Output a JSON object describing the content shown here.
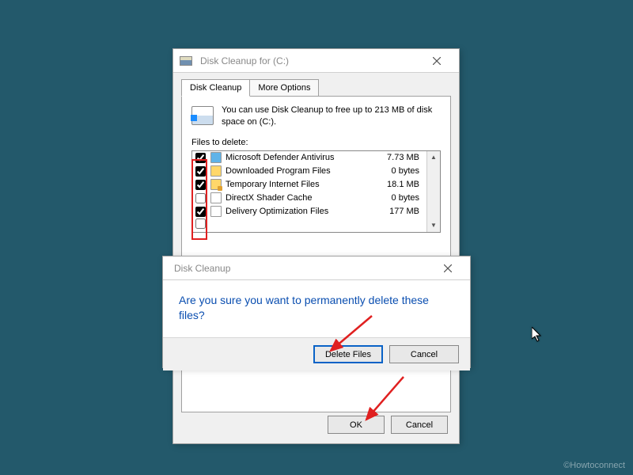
{
  "main": {
    "title": "Disk Cleanup for  (C:)",
    "tabs": [
      "Disk Cleanup",
      "More Options"
    ],
    "info": "You can use Disk Cleanup to free up to 213 MB of disk space on  (C:).",
    "files_label": "Files to delete:",
    "items": [
      {
        "label": "Microsoft Defender Antivirus",
        "size": "7.73 MB",
        "checked": true,
        "icon": "blue"
      },
      {
        "label": "Downloaded Program Files",
        "size": "0 bytes",
        "checked": true,
        "icon": "yellow"
      },
      {
        "label": "Temporary Internet Files",
        "size": "18.1 MB",
        "checked": true,
        "icon": "lock"
      },
      {
        "label": "DirectX Shader Cache",
        "size": "0 bytes",
        "checked": false,
        "icon": "white"
      },
      {
        "label": "Delivery Optimization Files",
        "size": "177 MB",
        "checked": true,
        "icon": "white"
      }
    ],
    "ok": "OK",
    "cancel": "Cancel"
  },
  "confirm": {
    "title": "Disk Cleanup",
    "message": "Are you sure you want to permanently delete these files?",
    "delete": "Delete Files",
    "cancel": "Cancel"
  },
  "watermark": "©Howtoconnect"
}
